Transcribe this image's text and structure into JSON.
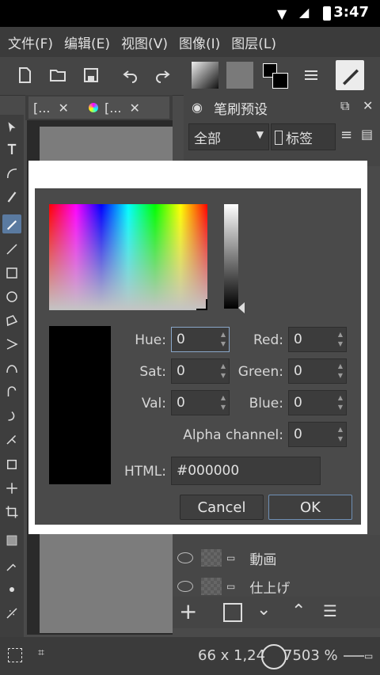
{
  "status": {
    "time": "3:47"
  },
  "menu": [
    {
      "label": "文件(F)"
    },
    {
      "label": "编辑(E)"
    },
    {
      "label": "视图(V)"
    },
    {
      "label": "图像(I)"
    },
    {
      "label": "图层(L)"
    }
  ],
  "tabs": [
    {
      "label": "[..."
    },
    {
      "label": "[..."
    }
  ],
  "brush_docker": {
    "title": "笔刷预设",
    "filter": "全部",
    "tag": "标签"
  },
  "layers": [
    {
      "name": "動画"
    },
    {
      "name": "仕上げ"
    }
  ],
  "bottom": {
    "coords": "66 x 1,24",
    "zoom": "7503 %"
  },
  "dialog": {
    "labels": {
      "hue": "Hue:",
      "sat": "Sat:",
      "val": "Val:",
      "red": "Red:",
      "green": "Green:",
      "blue": "Blue:",
      "alpha": "Alpha channel:",
      "html": "HTML:"
    },
    "values": {
      "hue": "0",
      "sat": "0",
      "val": "0",
      "red": "0",
      "green": "0",
      "blue": "0",
      "alpha": "0",
      "html": "#000000"
    },
    "buttons": {
      "cancel": "Cancel",
      "ok": "OK"
    }
  }
}
